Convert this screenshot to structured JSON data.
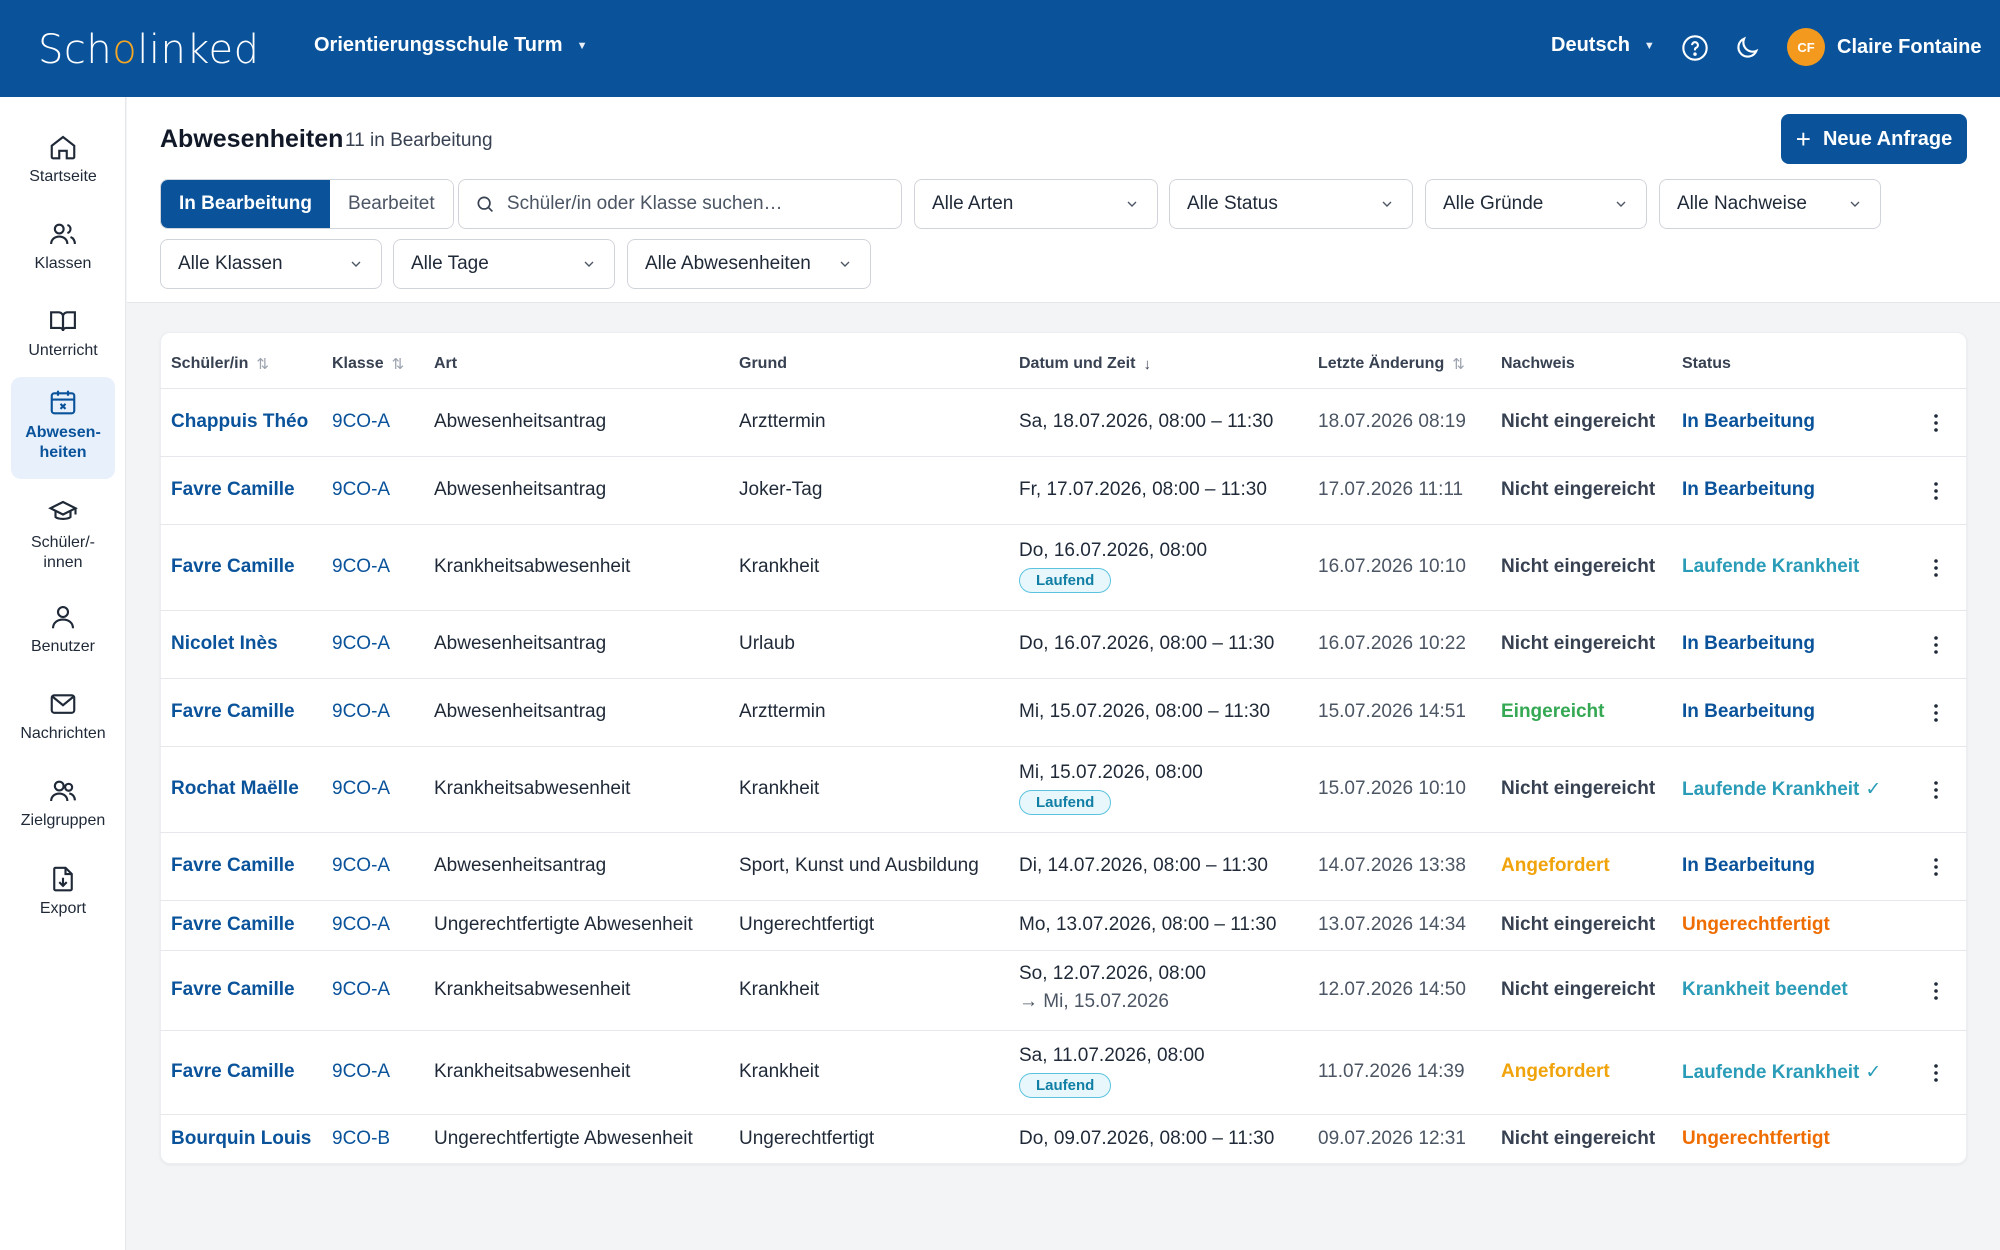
{
  "header": {
    "logo_text_1": "Sch",
    "logo_text_2": "o",
    "logo_text_3": "linked",
    "school": "Orientierungsschule Turm",
    "language": "Deutsch",
    "user_initials": "CF",
    "user_name": "Claire Fontaine"
  },
  "sidebar": {
    "items": [
      {
        "label": "Startseite",
        "icon": "home-icon"
      },
      {
        "label": "Klassen",
        "icon": "users-icon"
      },
      {
        "label": "Unterricht",
        "icon": "book-icon"
      },
      {
        "label": "Abwesen-heiten",
        "icon": "calendar-x-icon"
      },
      {
        "label": "Schüler/-innen",
        "icon": "graduation-cap-icon"
      },
      {
        "label": "Benutzer",
        "icon": "user-icon"
      },
      {
        "label": "Nachrichten",
        "icon": "mail-icon"
      },
      {
        "label": "Zielgruppen",
        "icon": "user-group-icon"
      },
      {
        "label": "Export",
        "icon": "file-download-icon"
      }
    ]
  },
  "page": {
    "title": "Abwesenheiten",
    "subtitle": "11 in Bearbeitung",
    "new_button": "Neue Anfrage",
    "tabs": [
      "In Bearbeitung",
      "Bearbeitet"
    ],
    "search_placeholder": "Schüler/in oder Klasse suchen…",
    "filters": [
      "Alle Arten",
      "Alle Status",
      "Alle Gründe",
      "Alle Nachweise",
      "Alle Klassen",
      "Alle Tage",
      "Alle Abwesenheiten"
    ]
  },
  "table": {
    "columns": [
      "Schüler/in",
      "Klasse",
      "Art",
      "Grund",
      "Datum und Zeit",
      "Letzte Änderung",
      "Nachweis",
      "Status"
    ],
    "rows": [
      {
        "name": "Chappuis Théo",
        "klasse": "9CO-A",
        "art": "Abwesenheitsantrag",
        "grund": "Arzttermin",
        "date": "Sa, 18.07.2026, 08:00 – 11:30",
        "date2": "",
        "pill": "",
        "last": "18.07.2026 08:19",
        "nachweis": "Nicht eingereicht",
        "status": "In Bearbeitung"
      },
      {
        "name": "Favre Camille",
        "klasse": "9CO-A",
        "art": "Abwesenheitsantrag",
        "grund": "Joker-Tag",
        "date": "Fr, 17.07.2026, 08:00 – 11:30",
        "date2": "",
        "pill": "",
        "last": "17.07.2026 11:11",
        "nachweis": "Nicht eingereicht",
        "status": "In Bearbeitung"
      },
      {
        "name": "Favre Camille",
        "klasse": "9CO-A",
        "art": "Krankheitsabwesenheit",
        "grund": "Krankheit",
        "date": "Do, 16.07.2026, 08:00",
        "date2": "",
        "pill": "Laufend",
        "last": "16.07.2026 10:10",
        "nachweis": "Nicht eingereicht",
        "status": "Laufende Krankheit"
      },
      {
        "name": "Nicolet Inès",
        "klasse": "9CO-A",
        "art": "Abwesenheitsantrag",
        "grund": "Urlaub",
        "date": "Do, 16.07.2026, 08:00 – 11:30",
        "date2": "",
        "pill": "",
        "last": "16.07.2026 10:22",
        "nachweis": "Nicht eingereicht",
        "status": "In Bearbeitung"
      },
      {
        "name": "Favre Camille",
        "klasse": "9CO-A",
        "art": "Abwesenheitsantrag",
        "grund": "Arzttermin",
        "date": "Mi, 15.07.2026, 08:00 – 11:30",
        "date2": "",
        "pill": "",
        "last": "15.07.2026 14:51",
        "nachweis": "Eingereicht",
        "status": "In Bearbeitung"
      },
      {
        "name": "Rochat Maëlle",
        "klasse": "9CO-A",
        "art": "Krankheitsabwesenheit",
        "grund": "Krankheit",
        "date": "Mi, 15.07.2026, 08:00",
        "date2": "",
        "pill": "Laufend",
        "last": "15.07.2026 10:10",
        "nachweis": "Nicht eingereicht",
        "status": "Laufende Krankheit",
        "check": "✓"
      },
      {
        "name": "Favre Camille",
        "klasse": "9CO-A",
        "art": "Abwesenheitsantrag",
        "grund": "Sport, Kunst und Ausbildung",
        "date": "Di, 14.07.2026, 08:00 – 11:30",
        "date2": "",
        "pill": "",
        "last": "14.07.2026 13:38",
        "nachweis": "Angefordert",
        "status": "In Bearbeitung"
      },
      {
        "name": "Favre Camille",
        "klasse": "9CO-A",
        "art": "Ungerechtfertigte Abwesenheit",
        "grund": "Ungerechtfertigt",
        "date": "Mo, 13.07.2026, 08:00 – 11:30",
        "date2": "",
        "pill": "",
        "last": "13.07.2026 14:34",
        "nachweis": "Nicht eingereicht",
        "status": "Ungerechtfertigt"
      },
      {
        "name": "Favre Camille",
        "klasse": "9CO-A",
        "art": "Krankheitsabwesenheit",
        "grund": "Krankheit",
        "date": "So, 12.07.2026, 08:00",
        "date2": "→ Mi, 15.07.2026",
        "pill": "",
        "last": "12.07.2026 14:50",
        "nachweis": "Nicht eingereicht",
        "status": "Krankheit beendet"
      },
      {
        "name": "Favre Camille",
        "klasse": "9CO-A",
        "art": "Krankheitsabwesenheit",
        "grund": "Krankheit",
        "date": "Sa, 11.07.2026, 08:00",
        "date2": "",
        "pill": "Laufend",
        "last": "11.07.2026 14:39",
        "nachweis": "Angefordert",
        "status": "Laufende Krankheit",
        "check": "✓"
      },
      {
        "name": "Bourquin Louis",
        "klasse": "9CO-B",
        "art": "Ungerechtfertigte Abwesenheit",
        "grund": "Ungerechtfertigt",
        "date": "Do, 09.07.2026, 08:00 – 11:30",
        "date2": "",
        "pill": "",
        "last": "09.07.2026 12:31",
        "nachweis": "Nicht eingereicht",
        "status": "Ungerechtfertigt"
      }
    ]
  },
  "colors": {
    "brand": "#0a539b",
    "accent": "#f39a1e",
    "teal": "#2a9cb8",
    "orange": "#ef6c00",
    "green": "#34a853",
    "amber": "#f0a30a"
  }
}
